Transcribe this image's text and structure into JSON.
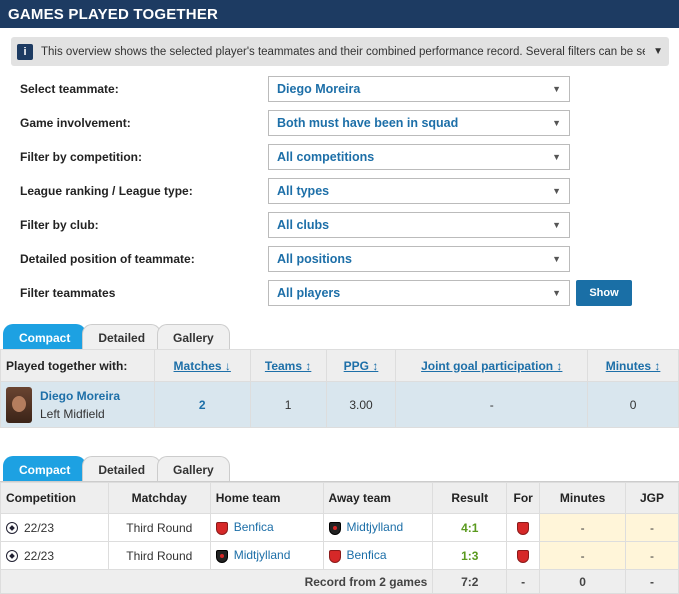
{
  "header": {
    "title": "GAMES PLAYED TOGETHER"
  },
  "info": {
    "icon": "info-icon",
    "text": "This overview shows the selected player's teammates and their combined performance record. Several filters can be selected. The list sho..."
  },
  "filters": [
    {
      "label": "Select teammate:",
      "value": "Diego Moreira"
    },
    {
      "label": "Game involvement:",
      "value": "Both must have been in squad"
    },
    {
      "label": "Filter by competition:",
      "value": "All competitions"
    },
    {
      "label": "League ranking / League type:",
      "value": "All types"
    },
    {
      "label": "Filter by club:",
      "value": "All clubs"
    },
    {
      "label": "Detailed position of teammate:",
      "value": "All positions"
    },
    {
      "label": "Filter teammates",
      "value": "All players"
    }
  ],
  "show_button": "Show",
  "tabs": [
    "Compact",
    "Detailed",
    "Gallery"
  ],
  "teammates_table": {
    "headers": [
      "Played together with:",
      "Matches ↓",
      "Teams ↕",
      "PPG ↕",
      "Joint goal participation ↕",
      "Minutes ↕"
    ],
    "row": {
      "name": "Diego Moreira",
      "position": "Left Midfield",
      "matches": "2",
      "teams": "1",
      "ppg": "3.00",
      "jgp": "-",
      "minutes": "0"
    }
  },
  "matches_table": {
    "headers": [
      "Competition",
      "Matchday",
      "Home team",
      "Away team",
      "Result",
      "For",
      "Minutes",
      "JGP"
    ],
    "rows": [
      {
        "season": "22/23",
        "matchday": "Third Round",
        "home": "Benfica",
        "away": "Midtjylland",
        "result": "4:1",
        "minutes": "-",
        "jgp": "-"
      },
      {
        "season": "22/23",
        "matchday": "Third Round",
        "home": "Midtjylland",
        "away": "Benfica",
        "result": "1:3",
        "minutes": "-",
        "jgp": "-"
      }
    ],
    "footer": {
      "label": "Record from 2 games",
      "result": "7:2",
      "for": "-",
      "minutes": "0",
      "jgp": "-"
    }
  }
}
